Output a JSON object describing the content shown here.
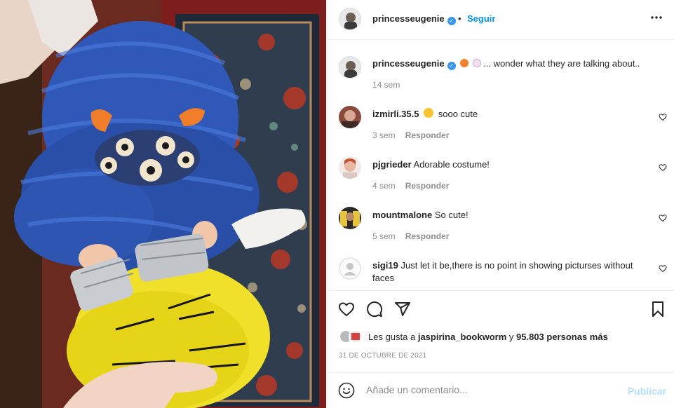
{
  "post": {
    "author": "princesseugenie",
    "follow_label": "Seguir",
    "dot": "•",
    "more_icon": "more-options-icon",
    "caption": {
      "author": "princesseugenie",
      "text": "... wonder what they are talking about..",
      "emojis": [
        "pumpkin",
        "ghost"
      ],
      "time": "14 sem"
    }
  },
  "comments": [
    {
      "user": "izmirli.35.5",
      "text": "sooo cute",
      "emoji": "grinning-face",
      "time": "3 sem",
      "reply": "Responder"
    },
    {
      "user": "pjgrieder",
      "text": "Adorable costume!",
      "time": "4 sem",
      "reply": "Responder"
    },
    {
      "user": "mountmalone",
      "text": "So cute!",
      "time": "5 sem",
      "reply": "Responder"
    },
    {
      "user": "sigi19",
      "text": "Just let it be,there is no point in showing picturses without faces"
    }
  ],
  "likes": {
    "prefix": "Les gusta a",
    "user": "jaspirina_bookworm",
    "middle": "y",
    "others": "95.803 personas más"
  },
  "date": "31 DE OCTUBRE DE 2021",
  "add_comment": {
    "placeholder": "Añade un comentario...",
    "publish": "Publicar"
  },
  "colors": {
    "link_blue": "#0095f6",
    "verified_blue": "#3897f0",
    "muted": "#8e8e8e",
    "publish_disabled": "#b2dffc"
  }
}
